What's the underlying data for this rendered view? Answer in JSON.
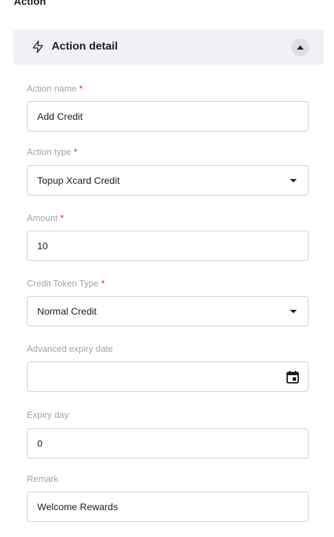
{
  "section": {
    "title": "Action"
  },
  "panel": {
    "header_label": "Action detail",
    "header_icon": "lightning-bolt-icon",
    "collapse_icon": "chevron-up-icon",
    "background": "#f3eff7"
  },
  "fields": {
    "action_name": {
      "label": "Action name",
      "required_mark": "*",
      "value": "Add Credit"
    },
    "action_type": {
      "label": "Action type",
      "required_mark": "*",
      "value": "Topup Xcard Credit"
    },
    "amount": {
      "label": "Amount",
      "required_mark": "*",
      "value": "10"
    },
    "credit_token_type": {
      "label": "Credit Token Type",
      "required_mark": "*",
      "value": "Normal Credit"
    },
    "advanced_expiry_date": {
      "label": "Advanced expiry date",
      "value": ""
    },
    "expiry_day": {
      "label": "Expiry day",
      "value": "0"
    },
    "remark": {
      "label": "Remark",
      "value": "Welcome Rewards"
    }
  },
  "colors": {
    "required": "#e0142c",
    "label": "#a3a3a3",
    "border": "#cfcfcf"
  }
}
